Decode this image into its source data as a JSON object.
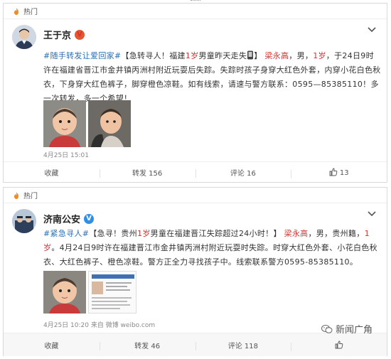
{
  "posts": [
    {
      "hot_label": "热门",
      "username": "王于京",
      "badge": "V",
      "text": {
        "tag": "#随手转发让爱回家#",
        "p1": "【急转寻人！福建",
        "p1_red": "1岁",
        "p2": "男童昨天走失",
        "p3": "】",
        "name_red": "梁永高",
        "p4": "，男，",
        "age_red": "1岁",
        "p5": "，于24日9时许在福建省晋江市金井镇丙洲村附近玩耍后失踪。失踪时孩子身穿大红色外套，内穿小花白色秋衣，下身穿大红色裤子，脚穿橙色凉鞋。如有线索，请速与警方联系：0595—85385110！多一次转发，多一个希望！"
      },
      "time": "4月25日 15:01",
      "actions": {
        "fav": "收藏",
        "repost": "转发 156",
        "comment": "评论 16",
        "like": "13"
      }
    },
    {
      "hot_label": "热门",
      "username": "济南公安",
      "badge": "V",
      "text": {
        "tag": "#紧急寻人#",
        "p1": "【急寻！贵州",
        "p1_red": "1岁",
        "p2": "男童在福建晋江失踪超过24小时！】",
        "name_red": "梁永高",
        "p4": "，男，贵州籍，",
        "age_red": "1岁",
        "p5": "。4月24日9时许在福建晋江市金井镇丙洲村附近玩耍时失踪。时穿大红色外套、小花白色秋衣、大红色裤子、橙色凉鞋。警方正全力寻找孩子中。线索联系警方0595-85385110。"
      },
      "time": "4月25日 10:20 来自 微博 weibo.com",
      "actions": {
        "fav": "收藏",
        "repost": "转发 46",
        "comment": "评论 118",
        "like": ""
      }
    }
  ],
  "watermark": "新闻广角",
  "colors": {
    "link": "#2a6fb6",
    "alert": "#d53333",
    "border": "#d9d9d9"
  }
}
